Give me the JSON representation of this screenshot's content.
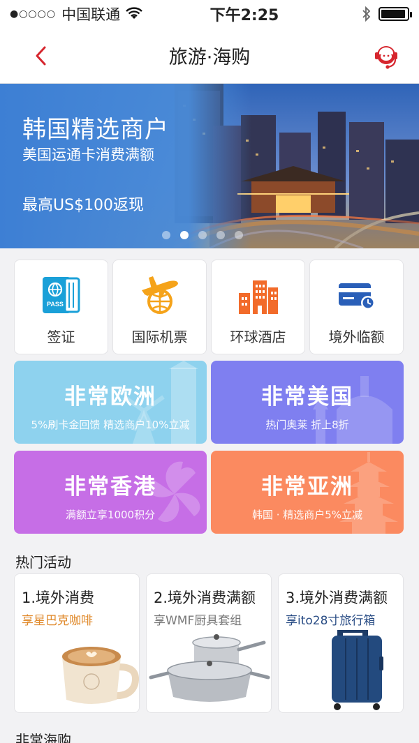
{
  "status_bar": {
    "signal": "●○○○○",
    "carrier": "中国联通",
    "time": "下午2:25",
    "battery_level": 0.95
  },
  "nav": {
    "title": "旅游·海购"
  },
  "banner": {
    "title": "韩国精选商户",
    "subtitle": "美国运通卡消费满额",
    "offer": "最高US$100返现",
    "slide_count": 5,
    "active_slide": 2
  },
  "services": [
    {
      "label": "签证",
      "icon": "passport-icon"
    },
    {
      "label": "国际机票",
      "icon": "plane-globe-icon"
    },
    {
      "label": "环球酒店",
      "icon": "hotel-buildings-icon"
    },
    {
      "label": "境外临额",
      "icon": "credit-card-icon"
    }
  ],
  "regions": [
    {
      "title": "非常欧洲",
      "desc": "5%刷卡金回馈 精选商户10%立减",
      "color": "#8ed2ee"
    },
    {
      "title": "非常美国",
      "desc": "热门奥莱 折上8折",
      "color": "#7f7ff0"
    },
    {
      "title": "非常香港",
      "desc": "满额立享1000积分",
      "color": "#c66ee6"
    },
    {
      "title": "非常亚洲",
      "desc": "韩国 · 精选商户5%立减",
      "color": "#fb8a60"
    }
  ],
  "hot_section": {
    "title": "热门活动",
    "items": [
      {
        "title": "1.境外消费",
        "subtitle": "享星巴克咖啡",
        "subtitle_color": "#e08a2c"
      },
      {
        "title": "2.境外消费满额",
        "subtitle": "享WMF厨具套组",
        "subtitle_color": "#777777"
      },
      {
        "title": "3.境外消费满额",
        "subtitle": "享ito28寸旅行箱",
        "subtitle_color": "#2a4d85"
      }
    ]
  },
  "next_section": {
    "title": "非常海购"
  },
  "colors": {
    "accent_red": "#d6262e",
    "passport_teal": "#1aa0d8",
    "plane_orange": "#f5a31a",
    "hotel_orange": "#f26b2a",
    "card_blue": "#2a5fb8"
  }
}
